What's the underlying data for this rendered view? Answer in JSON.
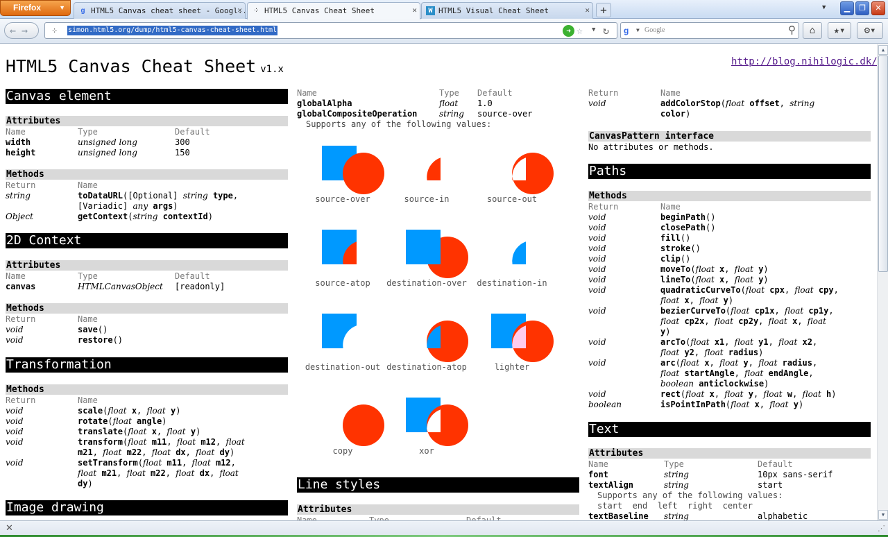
{
  "browser": {
    "app_button": "Firefox",
    "tabs": [
      {
        "label": "HTML5 Canvas cheat sheet - Googl...",
        "favicon": "google-icon"
      },
      {
        "label": "HTML5 Canvas Cheat Sheet",
        "favicon": "dots-icon"
      },
      {
        "label": "HTML5 Visual Cheat Sheet",
        "favicon": "w-icon"
      }
    ],
    "url": "simon.html5.org/dump/html5-canvas-cheat-sheet.html",
    "search_placeholder": "Google"
  },
  "page": {
    "title": "HTML5 Canvas Cheat Sheet",
    "version": "v1.x",
    "blog_link": "http://blog.nihilogic.dk/",
    "labels": {
      "name": "Name",
      "type": "Type",
      "default": "Default",
      "return": "Return"
    },
    "col1": {
      "canvas_element": "Canvas element",
      "attributes": "Attributes",
      "methods": "Methods",
      "width": {
        "name": "width",
        "type": "unsigned long",
        "default": "300"
      },
      "height": {
        "name": "height",
        "type": "unsigned long",
        "default": "150"
      },
      "m_todataurl": {
        "ret": "string",
        "name": "toDataURL",
        "args1": "([Optional] ",
        "arg1_type": "string",
        "arg1_name": "type",
        "args2": "[Variadic] ",
        "arg2_type": "any",
        "arg2_name": "args",
        "close": ")"
      },
      "m_getcontext": {
        "ret": "Object",
        "name": "getContext",
        "open": "(",
        "arg_type": "string",
        "arg_name": "contextId",
        "close": ")"
      },
      "ctx2d": "2D Context",
      "canvas_attr": {
        "name": "canvas",
        "type": "HTMLCanvasObject",
        "default": "[readonly]"
      },
      "save": {
        "ret": "void",
        "name": "save",
        "sig": "()"
      },
      "restore": {
        "ret": "void",
        "name": "restore",
        "sig": "()"
      },
      "transformation": "Transformation",
      "image_drawing": "Image drawing"
    },
    "col2": {
      "global_alpha": {
        "name": "globalAlpha",
        "type": "float",
        "default": "1.0"
      },
      "gco": {
        "name": "globalCompositeOperation",
        "type": "string",
        "default": "source-over"
      },
      "supports": "Supports any of the following values:",
      "composites": [
        "source-over",
        "source-in",
        "source-out",
        "source-atop",
        "destination-over",
        "destination-in",
        "destination-out",
        "destination-atop",
        "lighter",
        "copy",
        "xor"
      ],
      "line_styles": "Line styles",
      "attributes": "Attributes"
    },
    "col3": {
      "gradient_ret": "void",
      "gradient_name": "addColorStop",
      "pattern_header": "CanvasPattern interface",
      "pattern_text": "No attributes or methods.",
      "paths": "Paths",
      "methods": "Methods",
      "text": "Text",
      "attributes": "Attributes",
      "font": {
        "name": "font",
        "type": "string",
        "default": "10px sans-serif"
      },
      "text_align": {
        "name": "textAlign",
        "type": "string",
        "default": "start"
      },
      "supports": "Supports any of the following values:",
      "align_values": "start  end  left  right  center",
      "text_baseline": {
        "name": "textBaseline",
        "type": "string",
        "default": "alphabetic"
      }
    }
  },
  "colors": {
    "red": "#ff3300",
    "blue": "#0099ff",
    "pink": "#ffccee"
  }
}
